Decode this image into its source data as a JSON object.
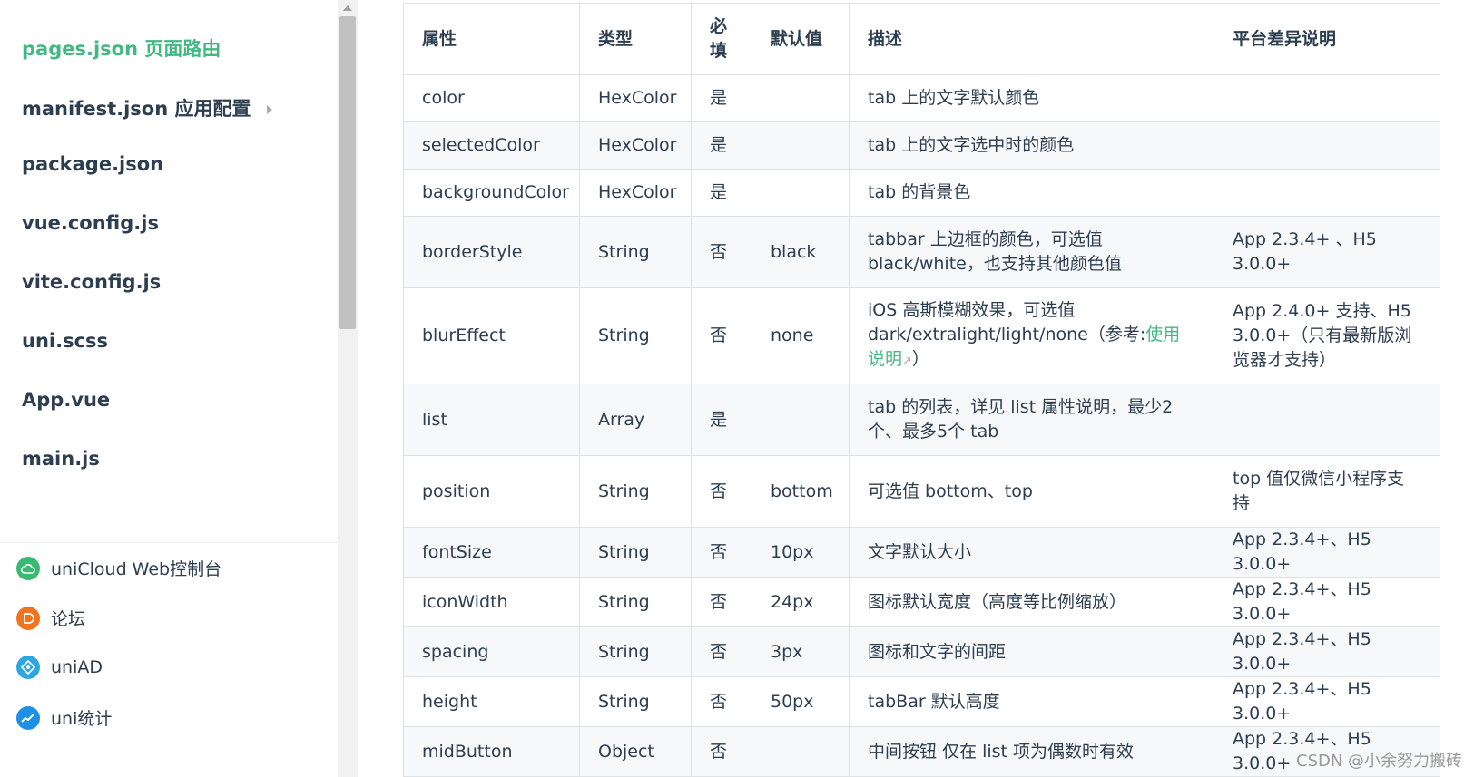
{
  "sidebar": {
    "nav": [
      {
        "label": "pages.json 页面路由",
        "active": true
      },
      {
        "label": "manifest.json 应用配置",
        "has_children": true
      },
      {
        "label": "package.json"
      },
      {
        "label": "vue.config.js"
      },
      {
        "label": "vite.config.js"
      },
      {
        "label": "uni.scss"
      },
      {
        "label": "App.vue"
      },
      {
        "label": "main.js"
      }
    ],
    "links": [
      {
        "label": "uniCloud Web控制台",
        "icon": "cloud-icon",
        "color": "#3bb872"
      },
      {
        "label": "论坛",
        "icon": "forum-icon",
        "color": "#f0731e"
      },
      {
        "label": "uniAD",
        "icon": "ad-icon",
        "color": "#2ea7e0"
      },
      {
        "label": "uni统计",
        "icon": "stats-icon",
        "color": "#1e90e8"
      }
    ]
  },
  "table": {
    "headers": [
      "属性",
      "类型",
      "必填",
      "默认值",
      "描述",
      "平台差异说明"
    ],
    "rows": [
      {
        "prop": "color",
        "type": "HexColor",
        "required": "是",
        "default": "",
        "desc": "tab 上的文字默认颜色",
        "platform": ""
      },
      {
        "prop": "selectedColor",
        "type": "HexColor",
        "required": "是",
        "default": "",
        "desc": "tab 上的文字选中时的颜色",
        "platform": ""
      },
      {
        "prop": "backgroundColor",
        "type": "HexColor",
        "required": "是",
        "default": "",
        "desc": "tab 的背景色",
        "platform": ""
      },
      {
        "prop": "borderStyle",
        "type": "String",
        "required": "否",
        "default": "black",
        "desc": "tabbar 上边框的颜色，可选值 black/white，也支持其他颜色值",
        "platform": "App 2.3.4+ 、H5 3.0.0+"
      },
      {
        "prop": "blurEffect",
        "type": "String",
        "required": "否",
        "default": "none",
        "desc_prefix": "iOS 高斯模糊效果，可选值 dark/extralight/light/none（参考:",
        "desc_link": "使用说明",
        "desc_suffix": "）",
        "platform": "App 2.4.0+ 支持、H5 3.0.0+（只有最新版浏览器才支持）"
      },
      {
        "prop": "list",
        "type": "Array",
        "required": "是",
        "default": "",
        "desc": "tab 的列表，详见 list 属性说明，最少2个、最多5个 tab",
        "platform": ""
      },
      {
        "prop": "position",
        "type": "String",
        "required": "否",
        "default": "bottom",
        "desc": "可选值 bottom、top",
        "platform": "top 值仅微信小程序支持"
      },
      {
        "prop": "fontSize",
        "type": "String",
        "required": "否",
        "default": "10px",
        "desc": "文字默认大小",
        "platform": "App 2.3.4+、H5 3.0.0+"
      },
      {
        "prop": "iconWidth",
        "type": "String",
        "required": "否",
        "default": "24px",
        "desc": "图标默认宽度（高度等比例缩放）",
        "platform": "App 2.3.4+、H5 3.0.0+"
      },
      {
        "prop": "spacing",
        "type": "String",
        "required": "否",
        "default": "3px",
        "desc": "图标和文字的间距",
        "platform": "App 2.3.4+、H5 3.0.0+"
      },
      {
        "prop": "height",
        "type": "String",
        "required": "否",
        "default": "50px",
        "desc": "tabBar 默认高度",
        "platform": "App 2.3.4+、H5 3.0.0+"
      },
      {
        "prop": "midButton",
        "type": "Object",
        "required": "否",
        "default": "",
        "desc": "中间按钮 仅在 list 项为偶数时有效",
        "platform": "App 2.3.4+、H5 3.0.0+"
      }
    ]
  },
  "watermark": "CSDN @小余努力搬砖"
}
